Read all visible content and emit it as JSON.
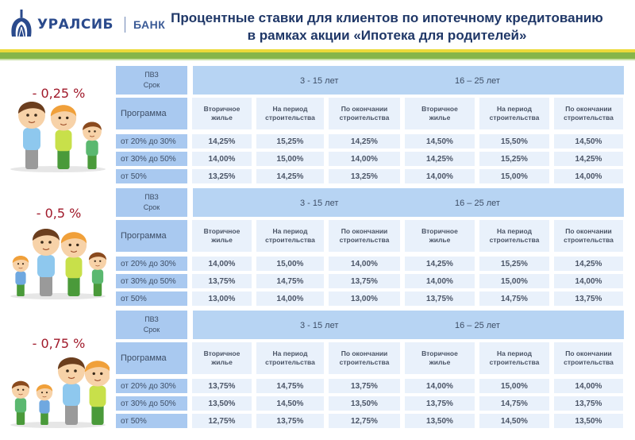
{
  "header": {
    "brand": "УРАЛСИБ",
    "brand_suffix": "БАНК",
    "title_line1": "Процентные ставки для клиентов по ипотечному кредитованию",
    "title_line2": "в рамках акции «Ипотека для родителей»"
  },
  "colors": {
    "brand_blue": "#2a4a8c",
    "title_blue": "#1f3767",
    "stripe_yellow": "#ecd93a",
    "stripe_green": "#86b54a",
    "discount_red": "#a0192a",
    "header_cell_blue": "#a9c9f0",
    "value_cell_blue": "#e9f1fb"
  },
  "table_labels": {
    "pvz": "ПВЗ",
    "term": "Срок",
    "program": "Программа",
    "term_group_1": "3 - 15 лет",
    "term_group_2": "16 – 25 лет",
    "columns": [
      [
        "Вторичное",
        "жилье"
      ],
      [
        "На период",
        "строительства"
      ],
      [
        "По окончании",
        "строительства"
      ],
      [
        "Вторичное",
        "жилье"
      ],
      [
        "На период",
        "строительства"
      ],
      [
        "По окончании",
        "строительства"
      ]
    ]
  },
  "blocks": [
    {
      "discount": "- 0,25 %",
      "rows": [
        {
          "program": "от 20% до 30%",
          "values": [
            "14,25%",
            "15,25%",
            "14,25%",
            "14,50%",
            "15,50%",
            "14,50%"
          ]
        },
        {
          "program": "от 30% до 50%",
          "values": [
            "14,00%",
            "15,00%",
            "14,00%",
            "14,25%",
            "15,25%",
            "14,25%"
          ]
        },
        {
          "program": "от 50%",
          "values": [
            "13,25%",
            "14,25%",
            "13,25%",
            "14,00%",
            "15,00%",
            "14,00%"
          ]
        }
      ]
    },
    {
      "discount": "- 0,5 %",
      "rows": [
        {
          "program": "от 20% до 30%",
          "values": [
            "14,00%",
            "15,00%",
            "14,00%",
            "14,25%",
            "15,25%",
            "14,25%"
          ]
        },
        {
          "program": "от 30% до 50%",
          "values": [
            "13,75%",
            "14,75%",
            "13,75%",
            "14,00%",
            "15,00%",
            "14,00%"
          ]
        },
        {
          "program": "от 50%",
          "values": [
            "13,00%",
            "14,00%",
            "13,00%",
            "13,75%",
            "14,75%",
            "13,75%"
          ]
        }
      ]
    },
    {
      "discount": "- 0,75 %",
      "rows": [
        {
          "program": "от 20% до 30%",
          "values": [
            "13,75%",
            "14,75%",
            "13,75%",
            "14,00%",
            "15,00%",
            "14,00%"
          ]
        },
        {
          "program": "от 30% до 50%",
          "values": [
            "13,50%",
            "14,50%",
            "13,50%",
            "13,75%",
            "14,75%",
            "13,75%"
          ]
        },
        {
          "program": "от 50%",
          "values": [
            "12,75%",
            "13,75%",
            "12,75%",
            "13,50%",
            "14,50%",
            "13,50%"
          ]
        }
      ]
    }
  ]
}
